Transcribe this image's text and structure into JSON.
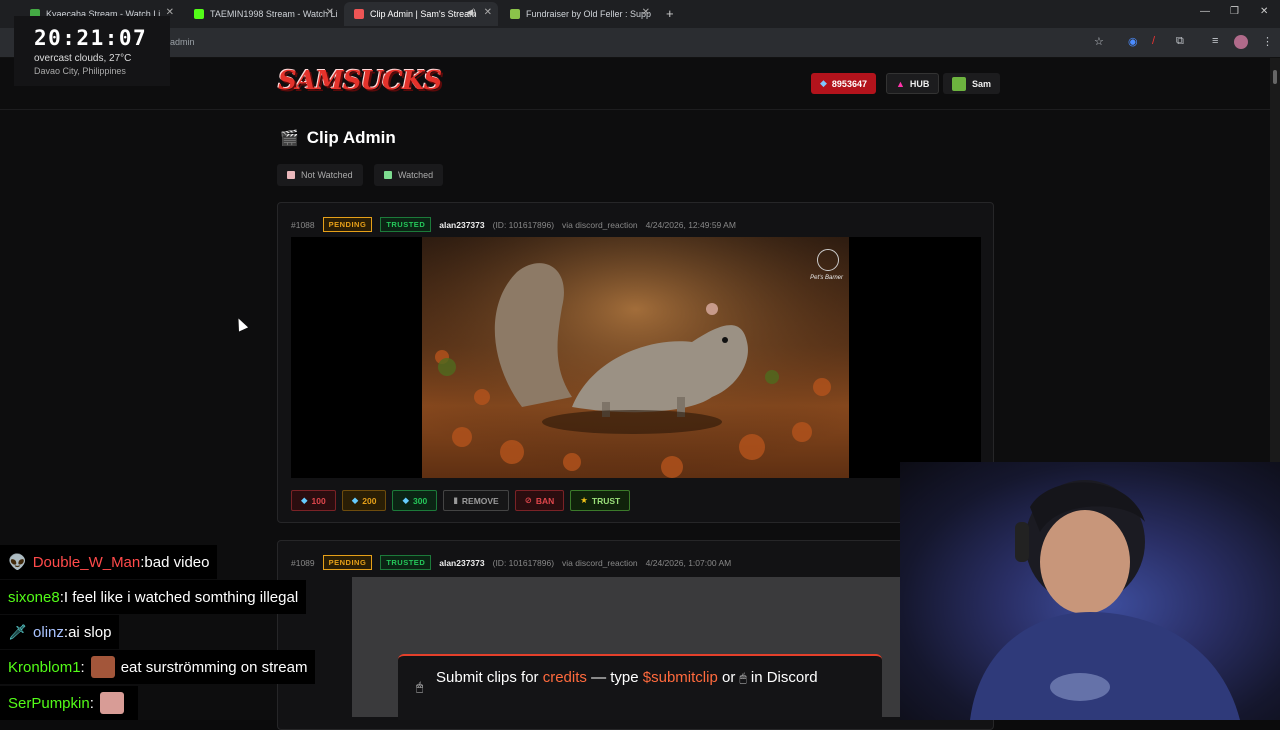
{
  "browser": {
    "tabs": [
      {
        "title": "Kyaecaha Stream - Watch Li",
        "color": "#4a4"
      },
      {
        "title": "TAEMIN1998 Stream - Watch Li",
        "color": "#53fc18"
      },
      {
        "title": "Clip Admin | Sam's Stream",
        "color": "#e55"
      },
      {
        "title": "Fundraiser by Old Feller : Supp",
        "color": "#8bc34a"
      }
    ],
    "url": "admin",
    "new_tab": "+"
  },
  "clock": {
    "time": "20:21:07",
    "weather": "overcast clouds, 27°C",
    "city": "Davao City, Philippines"
  },
  "header": {
    "logo": "SAMSUCKS",
    "credits": "8953647",
    "hub": "HUB",
    "user": "Sam"
  },
  "page": {
    "title": "Clip Admin",
    "filters": [
      {
        "label": "Not Watched",
        "color": "#e9b7bb"
      },
      {
        "label": "Watched",
        "color": "#7ddc8f"
      }
    ]
  },
  "clips": [
    {
      "id": "#1088",
      "status": "PENDING",
      "trust": "TRUSTED",
      "user": "alan237373",
      "user_id": "(ID: 101617896)",
      "via": "via discord_reaction",
      "date": "4/24/2026, 12:49:59 AM",
      "watermark": "Pet's Barner",
      "actions": [
        {
          "label": "100",
          "color": "#e0474c",
          "icon": "gem-icon"
        },
        {
          "label": "200",
          "color": "#e6a019",
          "icon": "gem-icon"
        },
        {
          "label": "300",
          "color": "#25c75a",
          "icon": "gem-icon"
        },
        {
          "label": "REMOVE",
          "color": "#9a9a9a",
          "icon": "trash-icon"
        },
        {
          "label": "BAN",
          "color": "#e0474c",
          "icon": "ban-icon"
        },
        {
          "label": "TRUST",
          "color": "#9be07a",
          "icon": "star-icon"
        }
      ]
    },
    {
      "id": "#1089",
      "status": "PENDING",
      "trust": "TRUSTED",
      "user": "alan237373",
      "user_id": "(ID: 101617896)",
      "via": "via discord_reaction",
      "date": "4/24/2026, 1:07:00 AM"
    }
  ],
  "chat": [
    {
      "user": "Double_W_Man",
      "user_color": "#ff4a4a",
      "message": "bad video"
    },
    {
      "user": "sixone8",
      "user_color": "#53fc18",
      "message": "I feel like i watched somthing illegal"
    },
    {
      "user": "olinz",
      "user_color": "#a9c3ff",
      "message": "ai slop"
    },
    {
      "user": "Kronblom1",
      "user_color": "#53fc18",
      "message": "eat surströmming on stream"
    },
    {
      "user": "SerPumpkin",
      "user_color": "#53fc18",
      "message": ""
    }
  ],
  "banner": {
    "prefix": "Submit clips for",
    "credits": "credits",
    "mid": "— type",
    "command": "$submitclip",
    "suffix": "or",
    "tail": "in Discord"
  }
}
